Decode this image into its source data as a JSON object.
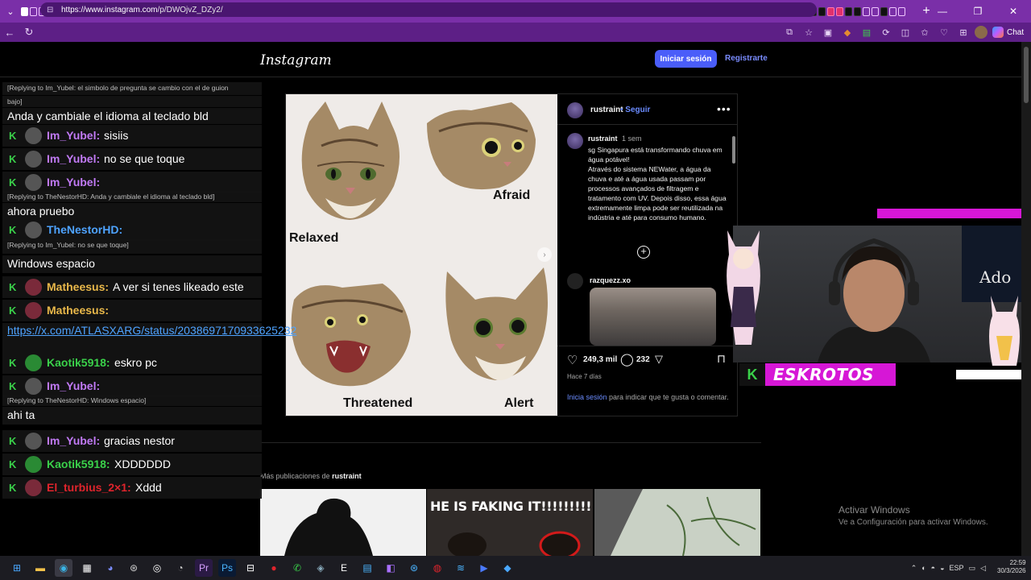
{
  "browser": {
    "url_host": "https://www.instagram.com",
    "url_path": "/p/DWOjvZ_DZy2/",
    "chat_label": "Chat"
  },
  "instagram": {
    "logo": "Instagram",
    "login_button": "Iniciar sesión",
    "signup_link": "Registrarte",
    "post": {
      "image_labels": {
        "relaxed": "Relaxed",
        "afraid": "Afraid",
        "threatened": "Threatened",
        "alert": "Alert"
      },
      "author": "rustraint",
      "follow": "• Seguir",
      "caption_user": "rustraint",
      "caption_time": "1 sem",
      "caption_text": "sg Singapura está transformando chuva em água potável!\nAtravés do sistema NEWater, a água da chuva e até a água usada passam por processos avançados de filtragem e tratamento com UV. Depois disso, essa água extremamente limpa pode ser reutilizada na indústria e até para consumo humano.",
      "reply_user": "razquezz.xo",
      "likes": "249,3 mil",
      "comments": "232",
      "date": "Hace 7 días",
      "login_prompt_link": "Inicia sesión",
      "login_prompt_rest": " para indicar que te gusta o comentar."
    },
    "more_from_prefix": "Más publicaciones de ",
    "more_from_user": "rustraint",
    "grid2_text": "HE IS FAKING IT!!!!!!!!!"
  },
  "windows_watermark": {
    "title": "Activar Windows",
    "subtitle": "Ve a Configuración para activar Windows."
  },
  "stream": {
    "channel_name": "ESKROTOS",
    "poster_text": "Ado"
  },
  "chat": {
    "rows": [
      {
        "type": "reply",
        "text": "[Replying to Im_Yubel: el simbolo de pregunta se cambio con el de guion"
      },
      {
        "type": "reply",
        "text": "bajo]"
      },
      {
        "type": "text",
        "text": "Anda y cambiale el idioma al teclado bld"
      },
      {
        "type": "msg",
        "user": "Im_Yubel:",
        "text": "sisiis",
        "color": "#c17af5"
      },
      {
        "type": "msg",
        "user": "Im_Yubel:",
        "text": "no se que toque",
        "color": "#c17af5"
      },
      {
        "type": "msg",
        "user": "Im_Yubel:",
        "text": "",
        "color": "#c17af5"
      },
      {
        "type": "reply",
        "text": "[Replying to TheNestorHD: Anda y cambiale el idioma al teclado bld]"
      },
      {
        "type": "text",
        "text": "ahora pruebo"
      },
      {
        "type": "msg",
        "user": "TheNestorHD:",
        "text": "",
        "color": "#4ea3ff"
      },
      {
        "type": "reply",
        "text": "[Replying to Im_Yubel: no se que toque]"
      },
      {
        "type": "text",
        "text": "Windows espacio"
      },
      {
        "type": "msg",
        "user": "Matheesus:",
        "text": "A ver si tenes likeado este",
        "color": "#e9b84a"
      },
      {
        "type": "msg",
        "user": "Matheesus:",
        "text": "",
        "color": "#e9b84a"
      },
      {
        "type": "link",
        "text": "https://x.com/ATLASXARG/status/2038697170933625232"
      },
      {
        "type": "msg",
        "user": "Kaotik5918:",
        "text": "eskro pc",
        "color": "#3ad14a"
      },
      {
        "type": "msg",
        "user": "Im_Yubel:",
        "text": "",
        "color": "#c17af5"
      },
      {
        "type": "reply",
        "text": "[Replying to TheNestorHD: Windows espacio]"
      },
      {
        "type": "text",
        "text": "ahi ta"
      },
      {
        "type": "msg",
        "user": "Im_Yubel:",
        "text": "gracias nestor",
        "color": "#c17af5"
      },
      {
        "type": "msg",
        "user": "Kaotik5918:",
        "text": "XDDDDDD",
        "color": "#3ad14a"
      },
      {
        "type": "msg",
        "user": "El_turbius_2×1:",
        "text": "Xddd",
        "color": "#e0242c"
      }
    ]
  },
  "taskbar": {
    "lang": "ESP",
    "time": "22:59",
    "date": "30/3/2026"
  }
}
